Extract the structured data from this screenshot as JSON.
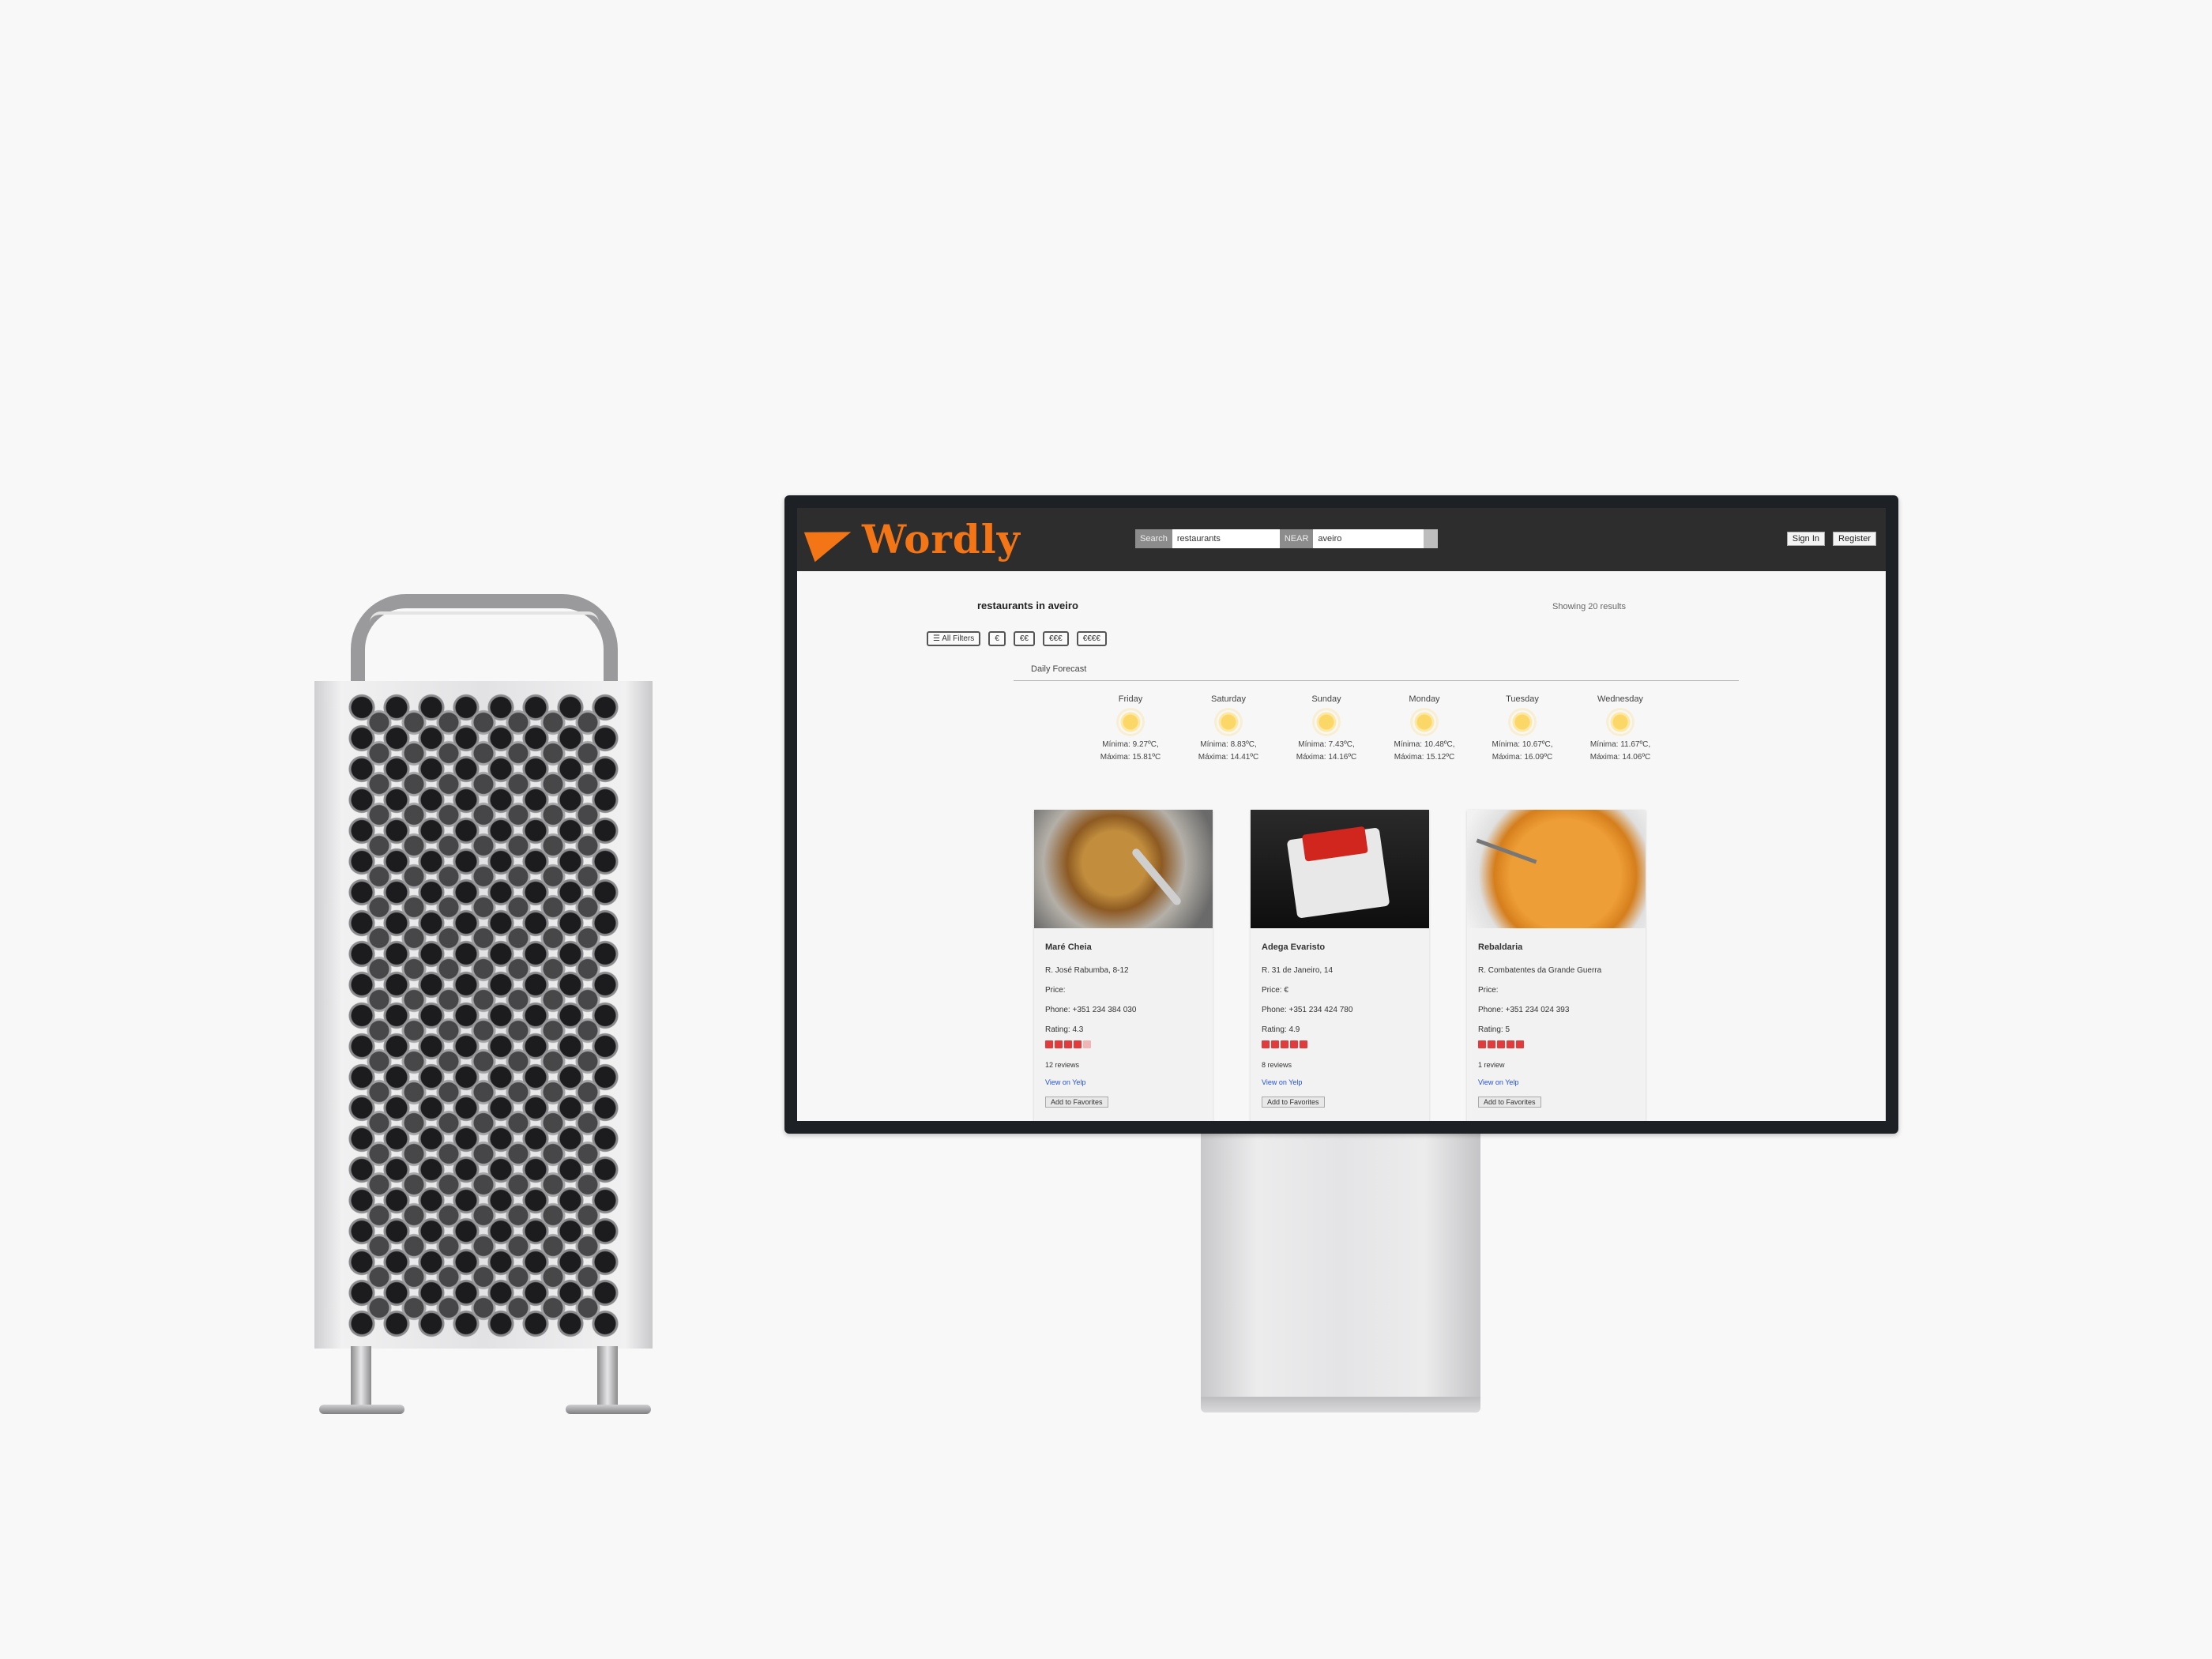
{
  "brand": {
    "name": "Wordly",
    "accent": "#f37516"
  },
  "search": {
    "search_tag": "Search",
    "search_value": "restaurants",
    "near_tag": "NEAR",
    "near_value": "aveiro"
  },
  "auth": {
    "sign_in": "Sign In",
    "register": "Register"
  },
  "page": {
    "title": "restaurants in aveiro",
    "results": "Showing 20 results"
  },
  "filters": [
    "☰ All Filters",
    "€",
    "€€",
    "€€€",
    "€€€€"
  ],
  "forecast": {
    "label": "Daily Forecast",
    "days": [
      {
        "name": "Friday",
        "min": "Mínima: 9.27ºC,",
        "max": "Máxima: 15.81ºC"
      },
      {
        "name": "Saturday",
        "min": "Mínima: 8.83ºC,",
        "max": "Máxima: 14.41ºC"
      },
      {
        "name": "Sunday",
        "min": "Mínima: 7.43ºC,",
        "max": "Máxima: 14.16ºC"
      },
      {
        "name": "Monday",
        "min": "Mínima: 10.48ºC,",
        "max": "Máxima: 15.12ºC"
      },
      {
        "name": "Tuesday",
        "min": "Mínima: 10.67ºC,",
        "max": "Máxima: 16.09ºC"
      },
      {
        "name": "Wednesday",
        "min": "Mínima: 11.67ºC,",
        "max": "Máxima: 14.06ºC"
      }
    ]
  },
  "restaurants": [
    {
      "name": "Maré Cheia",
      "address": "R. José Rabumba, 8-12",
      "price": "Price:",
      "phone": "Phone: +351 234 384 030",
      "rating_label": "Rating: 4.3",
      "rating": 4.3,
      "reviews": "12 reviews",
      "yelp": "View on Yelp",
      "fav": "Add to Favorites"
    },
    {
      "name": "Adega Evaristo",
      "address": "R. 31 de Janeiro, 14",
      "price": "Price: €",
      "phone": "Phone: +351 234 424 780",
      "rating_label": "Rating: 4.9",
      "rating": 4.9,
      "reviews": "8 reviews",
      "yelp": "View on Yelp",
      "fav": "Add to Favorites"
    },
    {
      "name": "Rebaldaria",
      "address": "R. Combatentes da Grande Guerra",
      "price": "Price:",
      "phone": "Phone: +351 234 024 393",
      "rating_label": "Rating: 5",
      "rating": 5,
      "reviews": "1 review",
      "yelp": "View on Yelp",
      "fav": "Add to Favorites"
    }
  ]
}
